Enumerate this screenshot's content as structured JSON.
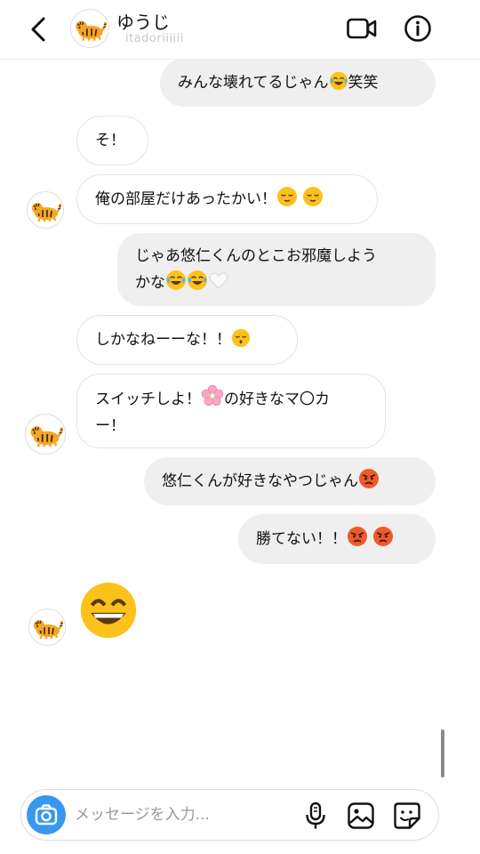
{
  "header": {
    "name": "ゆうじ",
    "username": "itadoriiiiii"
  },
  "messages": [
    {
      "side": "out",
      "text": "みんな壊れてるじゃん",
      "emojis": [
        "joy"
      ],
      "suffix": "笑笑"
    },
    {
      "side": "in",
      "text": "そ！"
    },
    {
      "side": "in",
      "text": "俺の部屋だけあったかい！",
      "emojis": [
        "relieved",
        "relieved"
      ],
      "avatar": true
    },
    {
      "side": "out",
      "line1": "じゃあ悠仁くんのとこお邪魔しよう",
      "line2": "かな",
      "emojis": [
        "joy",
        "joy",
        "white-heart"
      ]
    },
    {
      "side": "in",
      "text": "しかなねーーな！！",
      "emojis": [
        "kissing"
      ]
    },
    {
      "side": "in",
      "line1a": "スイッチしよ！",
      "line1b": "の好きなマ〇カ",
      "line2": "ー！",
      "emojis": [
        "cherry-blossom"
      ],
      "avatar": true
    },
    {
      "side": "out",
      "text": "悠仁くんが好きなやつじゃん",
      "emojis": [
        "angry"
      ]
    },
    {
      "side": "out",
      "text": "勝てない！！",
      "emojis": [
        "angry",
        "angry"
      ]
    },
    {
      "side": "in",
      "emojis": [
        "grinning"
      ],
      "avatar": true
    }
  ],
  "composer": {
    "placeholder": "メッセージを入力..."
  },
  "colors": {
    "out_bubble": "#efefef",
    "in_border": "#e3e3e3",
    "camera_blue": "#3897f0",
    "emoji_yellow": "#fcc21b",
    "angry_red": "#ef5a2a"
  }
}
